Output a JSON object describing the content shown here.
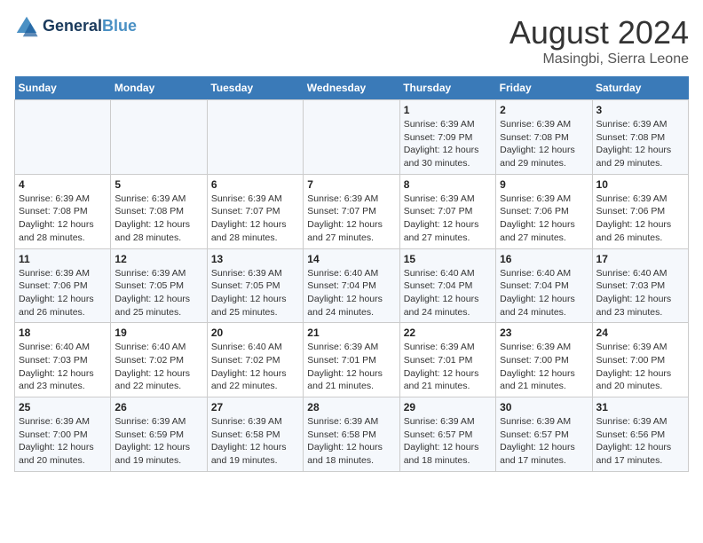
{
  "header": {
    "logo_line1": "General",
    "logo_line2": "Blue",
    "month_year": "August 2024",
    "location": "Masingbi, Sierra Leone"
  },
  "weekdays": [
    "Sunday",
    "Monday",
    "Tuesday",
    "Wednesday",
    "Thursday",
    "Friday",
    "Saturday"
  ],
  "weeks": [
    [
      {
        "day": "",
        "info": ""
      },
      {
        "day": "",
        "info": ""
      },
      {
        "day": "",
        "info": ""
      },
      {
        "day": "",
        "info": ""
      },
      {
        "day": "1",
        "info": "Sunrise: 6:39 AM\nSunset: 7:09 PM\nDaylight: 12 hours\nand 30 minutes."
      },
      {
        "day": "2",
        "info": "Sunrise: 6:39 AM\nSunset: 7:08 PM\nDaylight: 12 hours\nand 29 minutes."
      },
      {
        "day": "3",
        "info": "Sunrise: 6:39 AM\nSunset: 7:08 PM\nDaylight: 12 hours\nand 29 minutes."
      }
    ],
    [
      {
        "day": "4",
        "info": "Sunrise: 6:39 AM\nSunset: 7:08 PM\nDaylight: 12 hours\nand 28 minutes."
      },
      {
        "day": "5",
        "info": "Sunrise: 6:39 AM\nSunset: 7:08 PM\nDaylight: 12 hours\nand 28 minutes."
      },
      {
        "day": "6",
        "info": "Sunrise: 6:39 AM\nSunset: 7:07 PM\nDaylight: 12 hours\nand 28 minutes."
      },
      {
        "day": "7",
        "info": "Sunrise: 6:39 AM\nSunset: 7:07 PM\nDaylight: 12 hours\nand 27 minutes."
      },
      {
        "day": "8",
        "info": "Sunrise: 6:39 AM\nSunset: 7:07 PM\nDaylight: 12 hours\nand 27 minutes."
      },
      {
        "day": "9",
        "info": "Sunrise: 6:39 AM\nSunset: 7:06 PM\nDaylight: 12 hours\nand 27 minutes."
      },
      {
        "day": "10",
        "info": "Sunrise: 6:39 AM\nSunset: 7:06 PM\nDaylight: 12 hours\nand 26 minutes."
      }
    ],
    [
      {
        "day": "11",
        "info": "Sunrise: 6:39 AM\nSunset: 7:06 PM\nDaylight: 12 hours\nand 26 minutes."
      },
      {
        "day": "12",
        "info": "Sunrise: 6:39 AM\nSunset: 7:05 PM\nDaylight: 12 hours\nand 25 minutes."
      },
      {
        "day": "13",
        "info": "Sunrise: 6:39 AM\nSunset: 7:05 PM\nDaylight: 12 hours\nand 25 minutes."
      },
      {
        "day": "14",
        "info": "Sunrise: 6:40 AM\nSunset: 7:04 PM\nDaylight: 12 hours\nand 24 minutes."
      },
      {
        "day": "15",
        "info": "Sunrise: 6:40 AM\nSunset: 7:04 PM\nDaylight: 12 hours\nand 24 minutes."
      },
      {
        "day": "16",
        "info": "Sunrise: 6:40 AM\nSunset: 7:04 PM\nDaylight: 12 hours\nand 24 minutes."
      },
      {
        "day": "17",
        "info": "Sunrise: 6:40 AM\nSunset: 7:03 PM\nDaylight: 12 hours\nand 23 minutes."
      }
    ],
    [
      {
        "day": "18",
        "info": "Sunrise: 6:40 AM\nSunset: 7:03 PM\nDaylight: 12 hours\nand 23 minutes."
      },
      {
        "day": "19",
        "info": "Sunrise: 6:40 AM\nSunset: 7:02 PM\nDaylight: 12 hours\nand 22 minutes."
      },
      {
        "day": "20",
        "info": "Sunrise: 6:40 AM\nSunset: 7:02 PM\nDaylight: 12 hours\nand 22 minutes."
      },
      {
        "day": "21",
        "info": "Sunrise: 6:39 AM\nSunset: 7:01 PM\nDaylight: 12 hours\nand 21 minutes."
      },
      {
        "day": "22",
        "info": "Sunrise: 6:39 AM\nSunset: 7:01 PM\nDaylight: 12 hours\nand 21 minutes."
      },
      {
        "day": "23",
        "info": "Sunrise: 6:39 AM\nSunset: 7:00 PM\nDaylight: 12 hours\nand 21 minutes."
      },
      {
        "day": "24",
        "info": "Sunrise: 6:39 AM\nSunset: 7:00 PM\nDaylight: 12 hours\nand 20 minutes."
      }
    ],
    [
      {
        "day": "25",
        "info": "Sunrise: 6:39 AM\nSunset: 7:00 PM\nDaylight: 12 hours\nand 20 minutes."
      },
      {
        "day": "26",
        "info": "Sunrise: 6:39 AM\nSunset: 6:59 PM\nDaylight: 12 hours\nand 19 minutes."
      },
      {
        "day": "27",
        "info": "Sunrise: 6:39 AM\nSunset: 6:58 PM\nDaylight: 12 hours\nand 19 minutes."
      },
      {
        "day": "28",
        "info": "Sunrise: 6:39 AM\nSunset: 6:58 PM\nDaylight: 12 hours\nand 18 minutes."
      },
      {
        "day": "29",
        "info": "Sunrise: 6:39 AM\nSunset: 6:57 PM\nDaylight: 12 hours\nand 18 minutes."
      },
      {
        "day": "30",
        "info": "Sunrise: 6:39 AM\nSunset: 6:57 PM\nDaylight: 12 hours\nand 17 minutes."
      },
      {
        "day": "31",
        "info": "Sunrise: 6:39 AM\nSunset: 6:56 PM\nDaylight: 12 hours\nand 17 minutes."
      }
    ]
  ]
}
